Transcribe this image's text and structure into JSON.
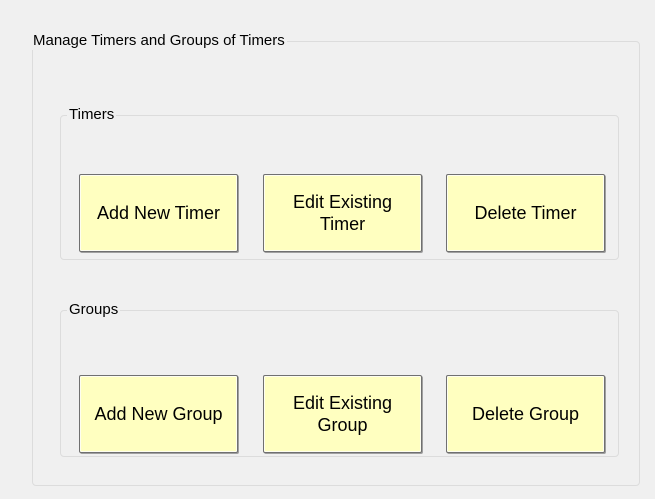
{
  "outer_group": {
    "title": "Manage Timers and Groups of Timers"
  },
  "timers_group": {
    "title": "Timers",
    "buttons": {
      "add": "Add New Timer",
      "edit": "Edit Existing Timer",
      "delete": "Delete Timer"
    }
  },
  "groups_group": {
    "title": "Groups",
    "buttons": {
      "add": "Add New Group",
      "edit": "Edit Existing Group",
      "delete": "Delete Group"
    }
  },
  "colors": {
    "window_background": "#f0f0f0",
    "button_background": "#ffffc0",
    "button_border": "#707070",
    "groupbox_border": "#dcdcdc"
  }
}
